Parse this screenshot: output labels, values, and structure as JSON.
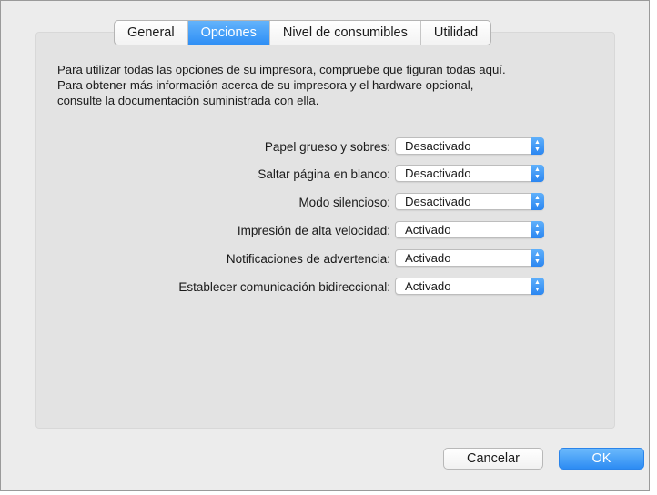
{
  "tabs": [
    {
      "label": "General",
      "active": false
    },
    {
      "label": "Opciones",
      "active": true
    },
    {
      "label": "Nivel de consumibles",
      "active": false
    },
    {
      "label": "Utilidad",
      "active": false
    }
  ],
  "intro": {
    "line1": "Para utilizar todas las opciones de su impresora, compruebe que figuran todas aquí.",
    "line2": "Para obtener más información acerca de su impresora y el hardware opcional,",
    "line3": "consulte la documentación suministrada con ella."
  },
  "options": [
    {
      "label": "Papel grueso y sobres:",
      "value": "Desactivado"
    },
    {
      "label": "Saltar página en blanco:",
      "value": "Desactivado"
    },
    {
      "label": "Modo silencioso:",
      "value": "Desactivado"
    },
    {
      "label": "Impresión de alta velocidad:",
      "value": "Activado"
    },
    {
      "label": "Notificaciones de advertencia:",
      "value": "Activado"
    },
    {
      "label": "Establecer comunicación bidireccional:",
      "value": "Activado"
    }
  ],
  "buttons": {
    "cancel": "Cancelar",
    "ok": "OK"
  },
  "colors": {
    "accent": "#2f8ff5",
    "window_bg": "#ececec",
    "panel_bg": "#e3e3e3"
  }
}
